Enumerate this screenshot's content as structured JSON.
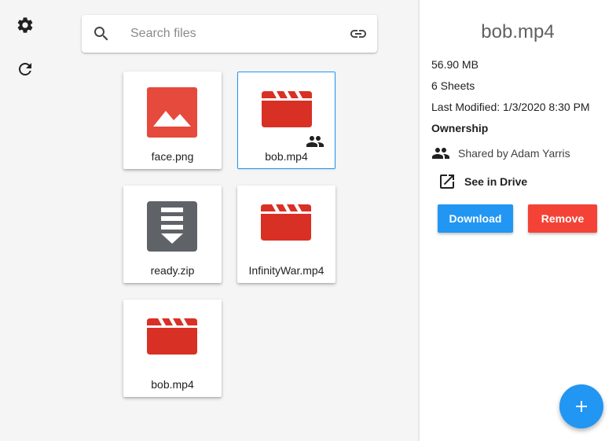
{
  "rail": {
    "items": [
      {
        "icon": "settings-icon"
      },
      {
        "icon": "refresh-icon"
      }
    ]
  },
  "search": {
    "placeholder": "Search files",
    "value": ""
  },
  "files": [
    {
      "name": "face.png",
      "type": "image",
      "color": "#e54a3c",
      "shared": false,
      "selected": false
    },
    {
      "name": "bob.mp4",
      "type": "video",
      "color": "#d93025",
      "shared": true,
      "selected": true
    },
    {
      "name": "ready.zip",
      "type": "archive",
      "color": "#5f6368",
      "shared": false,
      "selected": false
    },
    {
      "name": "InfinityWar.mp4",
      "type": "video",
      "color": "#d93025",
      "shared": false,
      "selected": false
    },
    {
      "name": "bob.mp4",
      "type": "video",
      "color": "#d93025",
      "shared": false,
      "selected": false
    }
  ],
  "details": {
    "title": "bob.mp4",
    "size": "56.90 MB",
    "sheets": "6 Sheets",
    "modified": "Last Modified: 1/3/2020 8:30 PM",
    "ownership_label": "Ownership",
    "shared_by": "Shared by Adam Yarris",
    "drive_link": "See in Drive",
    "download_label": "Download",
    "remove_label": "Remove"
  },
  "colors": {
    "accent": "#2196f3",
    "danger": "#f44336"
  }
}
